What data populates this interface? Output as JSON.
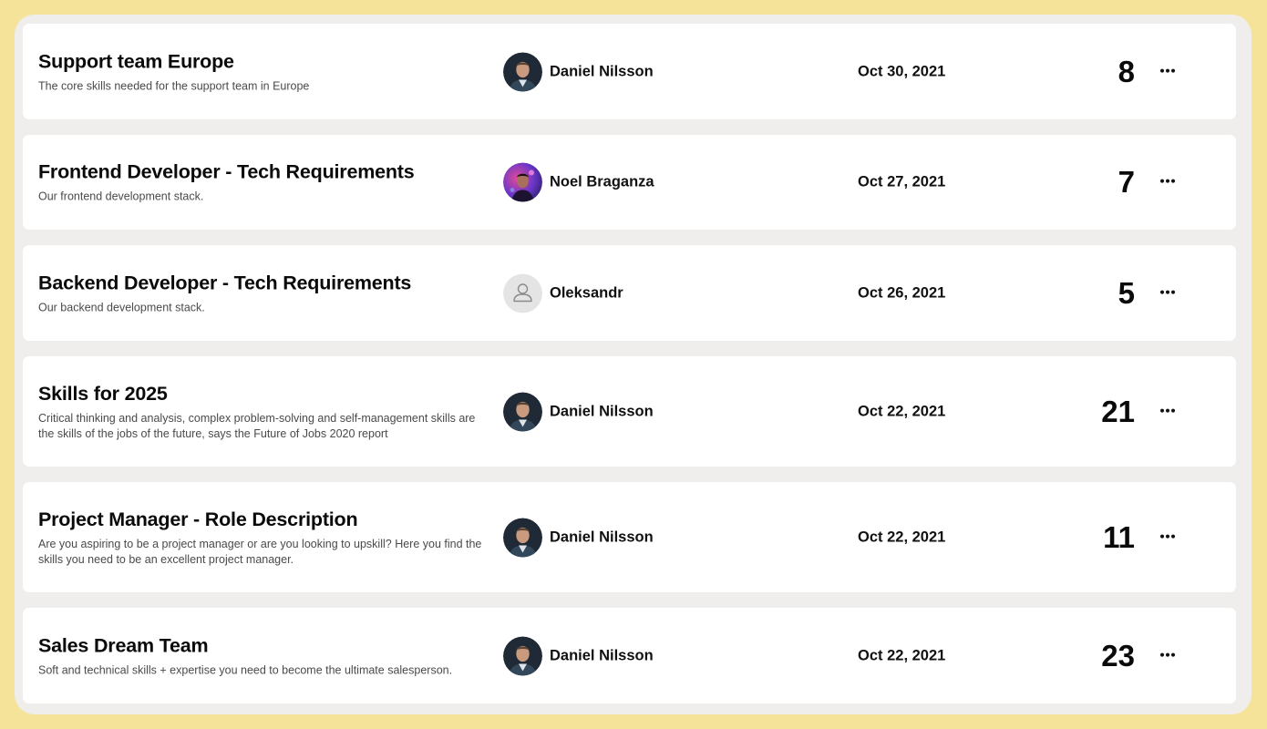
{
  "rows": [
    {
      "title": "Support team Europe",
      "description": "The core skills needed for the support team in Europe",
      "owner": "Daniel Nilsson",
      "avatar": "photo-daniel",
      "date": "Oct 30, 2021",
      "count": "8"
    },
    {
      "title": "Frontend Developer - Tech Requirements",
      "description": "Our frontend development stack.",
      "owner": "Noel Braganza",
      "avatar": "photo-noel",
      "date": "Oct 27, 2021",
      "count": "7"
    },
    {
      "title": "Backend Developer - Tech Requirements",
      "description": "Our backend development stack.",
      "owner": "Oleksandr",
      "avatar": "default-user-icon",
      "date": "Oct 26, 2021",
      "count": "5"
    },
    {
      "title": "Skills for 2025",
      "description": "Critical thinking and analysis, complex problem-solving and self-management skills are the skills of the jobs of the future, says the Future of Jobs 2020 report",
      "owner": "Daniel Nilsson",
      "avatar": "photo-daniel",
      "date": "Oct 22, 2021",
      "count": "21"
    },
    {
      "title": "Project Manager - Role Description",
      "description": "Are you aspiring to be a project manager or are you looking to upskill? Here you find the skills you need to be an excellent project manager.",
      "owner": "Daniel Nilsson",
      "avatar": "photo-daniel",
      "date": "Oct 22, 2021",
      "count": "11"
    },
    {
      "title": "Sales Dream Team",
      "description": "Soft and technical skills + expertise you need to become the ultimate salesperson.",
      "owner": "Daniel Nilsson",
      "avatar": "photo-daniel",
      "date": "Oct 22, 2021",
      "count": "23"
    }
  ],
  "row_menu_icon": "more-horizontal-icon",
  "colors": {
    "outer_background": "#f6e39a",
    "panel_background": "#efeeed",
    "card_background": "#ffffff",
    "title_text": "#0a0a0a",
    "description_text": "#4a4a4a"
  }
}
